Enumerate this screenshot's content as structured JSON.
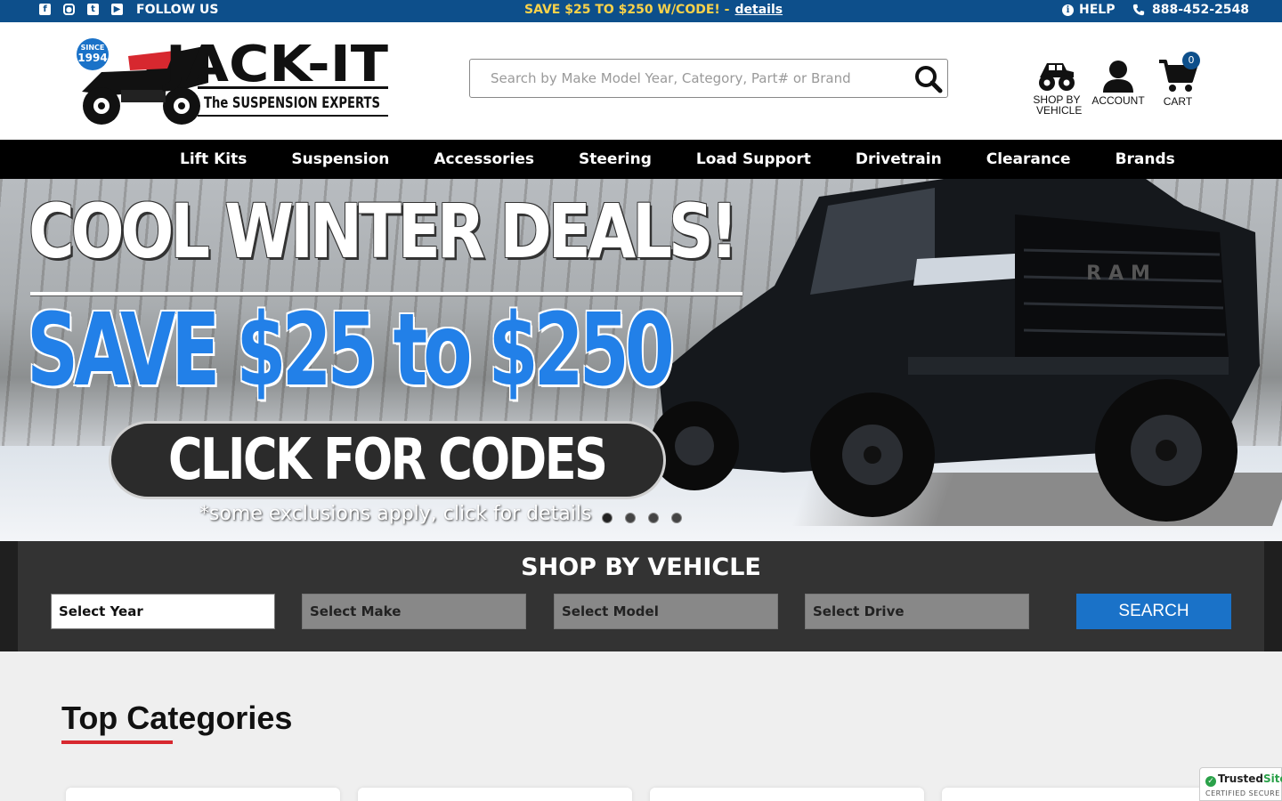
{
  "topbar": {
    "follow_label": "FOLLOW US",
    "social_icons": [
      "facebook-icon",
      "instagram-icon",
      "twitter-icon",
      "youtube-icon"
    ],
    "promo_text": "SAVE $25 TO $250 W/CODE! -",
    "promo_link": "details",
    "help_label": "HELP",
    "phone": "888-452-2548"
  },
  "header": {
    "logo": {
      "badge_top": "SINCE",
      "badge_year": "1994",
      "name": "JACK-IT",
      "tagline": "The SUSPENSION EXPERTS"
    },
    "search": {
      "placeholder": "Search by Make Model Year, Category, Part# or Brand"
    },
    "shop_by_vehicle_line1": "SHOP BY",
    "shop_by_vehicle_line2": "VEHICLE",
    "account_label": "ACCOUNT",
    "cart_label": "CART",
    "cart_count": "0"
  },
  "nav": {
    "items": [
      "Lift Kits",
      "Suspension",
      "Accessories",
      "Steering",
      "Load Support",
      "Drivetrain",
      "Clearance",
      "Brands"
    ]
  },
  "hero": {
    "headline": "COOL WINTER DEALS!",
    "save_text": "SAVE $25 to $250",
    "cta": "CLICK FOR CODES",
    "disclaimer": "*some exclusions apply, click for details",
    "truck_grille_text": "RAM",
    "slide_count": 4,
    "active_slide": 1
  },
  "shop_by_vehicle": {
    "title": "SHOP BY VEHICLE",
    "selects": [
      "Select Year",
      "Select Make",
      "Select Model",
      "Select Drive"
    ],
    "search_button": "SEARCH"
  },
  "categories": {
    "title": "Top Categories"
  },
  "trusted_site": {
    "brand_a": "Trusted",
    "brand_b": "Site",
    "tagline": "CERTIFIED SECURE"
  },
  "colors": {
    "brand_blue": "#0d4f8b",
    "promo_yellow": "#f9d24a",
    "search_blue": "#1a72c8",
    "accent_red": "#d7282f"
  }
}
